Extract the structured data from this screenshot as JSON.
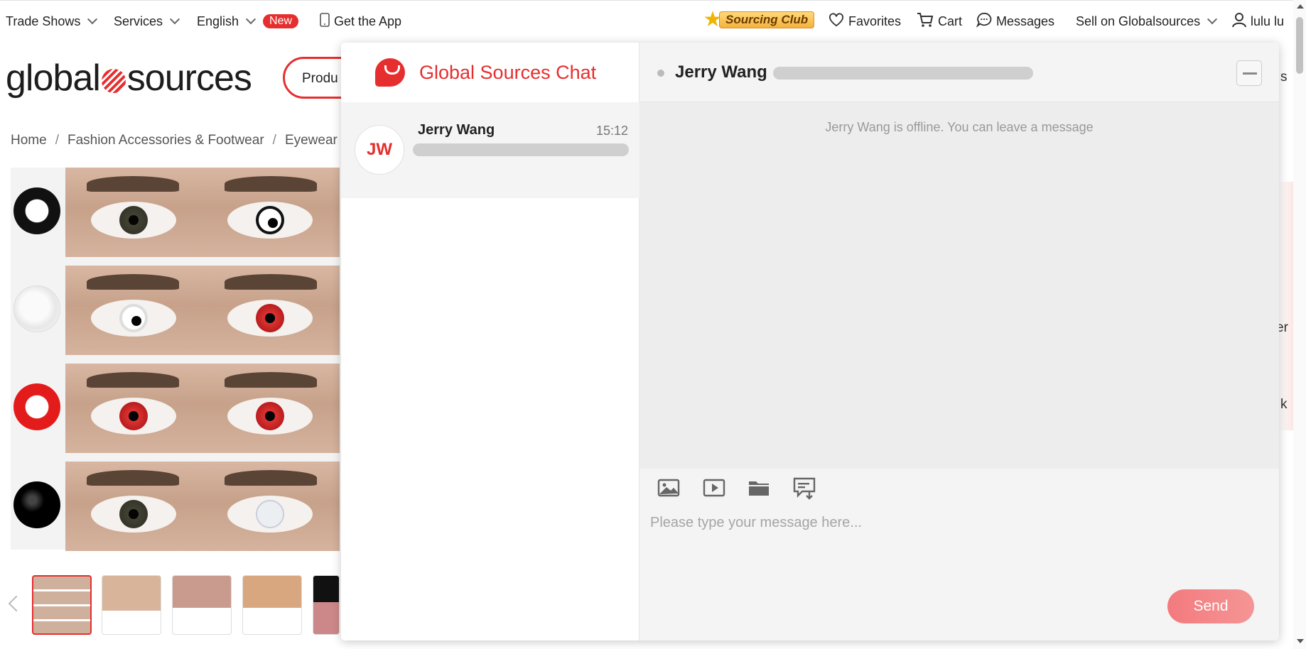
{
  "topnav": {
    "trade_shows": "Trade Shows",
    "services": "Services",
    "language": "English",
    "new_badge": "New",
    "get_app": "Get the App",
    "sourcing_club": "Sourcing Club",
    "favorites": "Favorites",
    "cart": "Cart",
    "messages": "Messages",
    "sell": "Sell on Globalsources",
    "user": "lulu lu"
  },
  "header": {
    "logo_left": "global",
    "logo_right": "sources",
    "search_partial": "Produ"
  },
  "breadcrumb": {
    "home": "Home",
    "category": "Fashion Accessories & Footwear",
    "subcategory": "Eyewear"
  },
  "edge": {
    "s": "s",
    "er": "er",
    "k": "k"
  },
  "chat": {
    "brand_title": "Global Sources Chat",
    "conversation": {
      "initials": "JW",
      "name": "Jerry Wang",
      "time": "15:12"
    },
    "header_name": "Jerry Wang",
    "offline_note": "Jerry Wang is offline. You can leave a message",
    "input_placeholder": "Please type your message here...",
    "send_label": "Send",
    "accent": "#e62e2e"
  }
}
